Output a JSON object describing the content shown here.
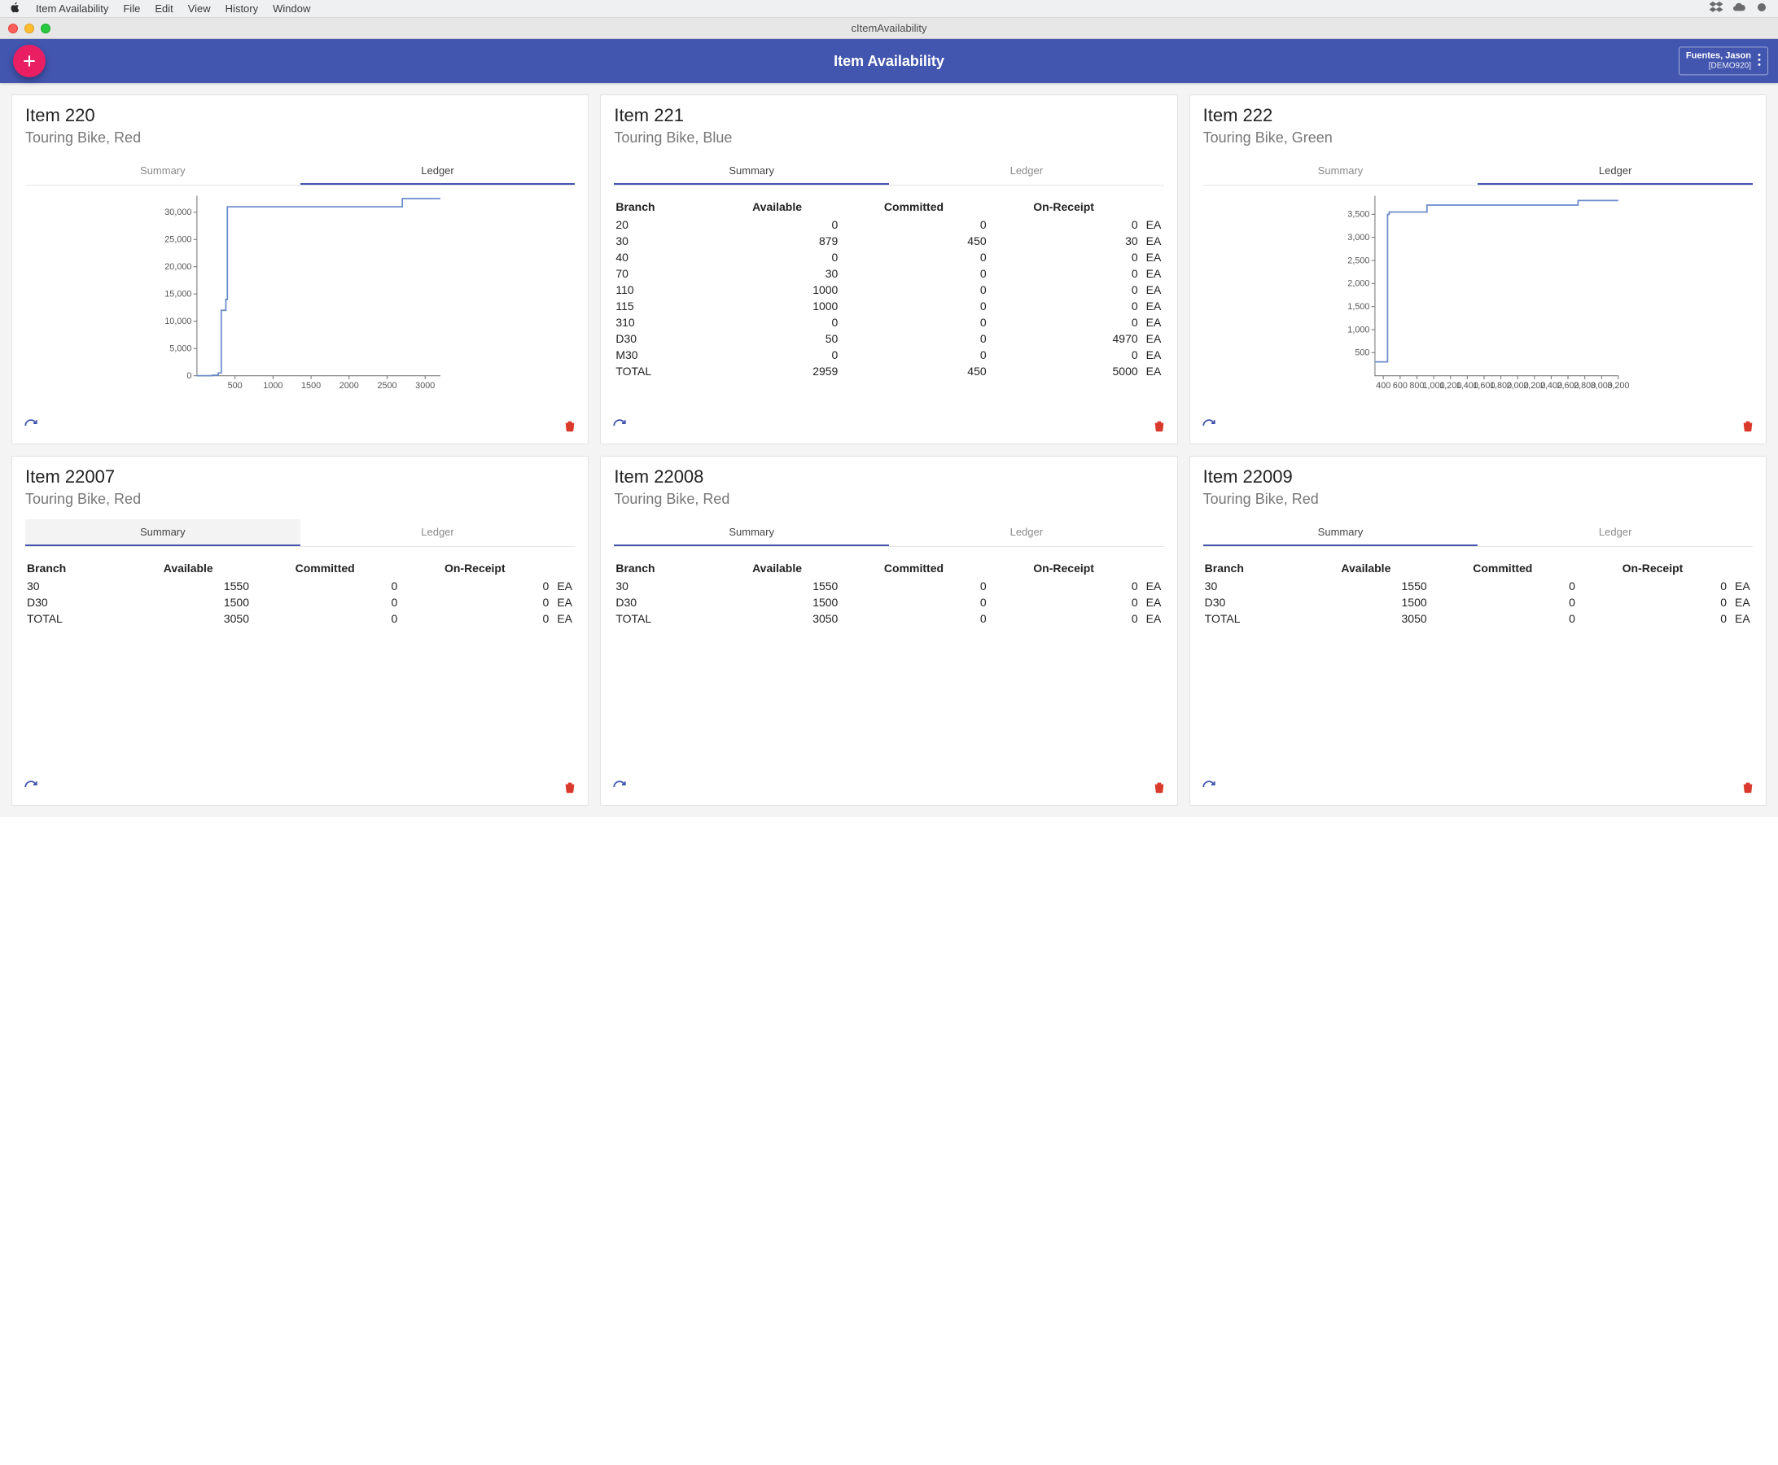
{
  "menubar": {
    "items": [
      "Item Availability",
      "File",
      "Edit",
      "View",
      "History",
      "Window"
    ]
  },
  "window": {
    "title": "cItemAvailability"
  },
  "header": {
    "title": "Item Availability",
    "user_name": "Fuentes, Jason",
    "user_env": "[DEMO920]"
  },
  "tabs": {
    "summary": "Summary",
    "ledger": "Ledger"
  },
  "columns": {
    "branch": "Branch",
    "available": "Available",
    "committed": "Committed",
    "on_receipt": "On-Receipt"
  },
  "unit": "EA",
  "total_label": "TOTAL",
  "cards": [
    {
      "code": "Item 220",
      "name": "Touring Bike, Red",
      "active_tab": "ledger",
      "mode": "chart",
      "chart_id": "chart1"
    },
    {
      "code": "Item 221",
      "name": "Touring Bike, Blue",
      "active_tab": "summary",
      "mode": "table",
      "rows": [
        {
          "branch": "20",
          "available": 0,
          "committed": 0,
          "on_receipt": 0,
          "unit": "EA"
        },
        {
          "branch": "30",
          "available": 879,
          "committed": 450,
          "on_receipt": 30,
          "unit": "EA"
        },
        {
          "branch": "40",
          "available": 0,
          "committed": 0,
          "on_receipt": 0,
          "unit": "EA"
        },
        {
          "branch": "70",
          "available": 30,
          "committed": 0,
          "on_receipt": 0,
          "unit": "EA"
        },
        {
          "branch": "110",
          "available": 1000,
          "committed": 0,
          "on_receipt": 0,
          "unit": "EA"
        },
        {
          "branch": "115",
          "available": 1000,
          "committed": 0,
          "on_receipt": 0,
          "unit": "EA"
        },
        {
          "branch": "310",
          "available": 0,
          "committed": 0,
          "on_receipt": 0,
          "unit": "EA"
        },
        {
          "branch": "D30",
          "available": 50,
          "committed": 0,
          "on_receipt": 4970,
          "unit": "EA"
        },
        {
          "branch": "M30",
          "available": 0,
          "committed": 0,
          "on_receipt": 0,
          "unit": "EA"
        }
      ],
      "total": {
        "available": 2959,
        "committed": 450,
        "on_receipt": 5000,
        "unit": "EA"
      }
    },
    {
      "code": "Item 222",
      "name": "Touring Bike, Green",
      "active_tab": "ledger",
      "mode": "chart",
      "chart_id": "chart2"
    },
    {
      "code": "Item 22007",
      "name": "Touring Bike, Red",
      "active_tab": "summary",
      "mode": "table",
      "rows": [
        {
          "branch": "30",
          "available": 1550,
          "committed": 0,
          "on_receipt": 0,
          "unit": "EA"
        },
        {
          "branch": "D30",
          "available": 1500,
          "committed": 0,
          "on_receipt": 0,
          "unit": "EA"
        }
      ],
      "total": {
        "available": 3050,
        "committed": 0,
        "on_receipt": 0,
        "unit": "EA"
      }
    },
    {
      "code": "Item 22008",
      "name": "Touring Bike, Red",
      "active_tab": "summary",
      "mode": "table",
      "rows": [
        {
          "branch": "30",
          "available": 1550,
          "committed": 0,
          "on_receipt": 0,
          "unit": "EA"
        },
        {
          "branch": "D30",
          "available": 1500,
          "committed": 0,
          "on_receipt": 0,
          "unit": "EA"
        }
      ],
      "total": {
        "available": 3050,
        "committed": 0,
        "on_receipt": 0,
        "unit": "EA"
      }
    },
    {
      "code": "Item 22009",
      "name": "Touring Bike, Red",
      "active_tab": "summary",
      "mode": "table",
      "rows": [
        {
          "branch": "30",
          "available": 1550,
          "committed": 0,
          "on_receipt": 0,
          "unit": "EA"
        },
        {
          "branch": "D30",
          "available": 1500,
          "committed": 0,
          "on_receipt": 0,
          "unit": "EA"
        }
      ],
      "total": {
        "available": 3050,
        "committed": 0,
        "on_receipt": 0,
        "unit": "EA"
      }
    }
  ],
  "chart_data": [
    {
      "id": "chart1",
      "type": "line",
      "title": "",
      "xlabel": "",
      "ylabel": "",
      "x": [
        0,
        200,
        280,
        320,
        380,
        400,
        2600,
        2700,
        3200
      ],
      "values": [
        0,
        100,
        500,
        12000,
        14000,
        31000,
        31000,
        32500,
        32500
      ],
      "xlim": [
        0,
        3200
      ],
      "ylim": [
        0,
        33000
      ],
      "xticks": [
        500,
        1000,
        1500,
        2000,
        2500,
        3000
      ],
      "yticks": [
        0,
        5000,
        10000,
        15000,
        20000,
        25000,
        30000
      ],
      "ytick_labels": [
        "0",
        "5,000",
        "10,000",
        "15,000",
        "20,000",
        "25,000",
        "30,000"
      ]
    },
    {
      "id": "chart2",
      "type": "line",
      "title": "",
      "xlabel": "",
      "ylabel": "",
      "x": [
        300,
        450,
        470,
        900,
        920,
        2700,
        2720,
        3200
      ],
      "values": [
        300,
        3500,
        3550,
        3550,
        3700,
        3700,
        3800,
        3800
      ],
      "xlim": [
        300,
        3200
      ],
      "ylim": [
        0,
        3900
      ],
      "xticks": [
        400,
        600,
        800,
        1000,
        1200,
        1400,
        1600,
        1800,
        2000,
        2200,
        2400,
        2600,
        2800,
        3000,
        3200
      ],
      "xtick_labels": [
        "400",
        "600",
        "800",
        "1,000",
        "1,200",
        "1,400",
        "1,600",
        "1,800",
        "2,000",
        "2,200",
        "2,400",
        "2,600",
        "2,800",
        "3,000",
        "3,200"
      ],
      "yticks": [
        500,
        1000,
        1500,
        2000,
        2500,
        3000,
        3500
      ],
      "ytick_labels": [
        "500",
        "1,000",
        "1,500",
        "2,000",
        "2,500",
        "3,000",
        "3,500"
      ]
    }
  ]
}
